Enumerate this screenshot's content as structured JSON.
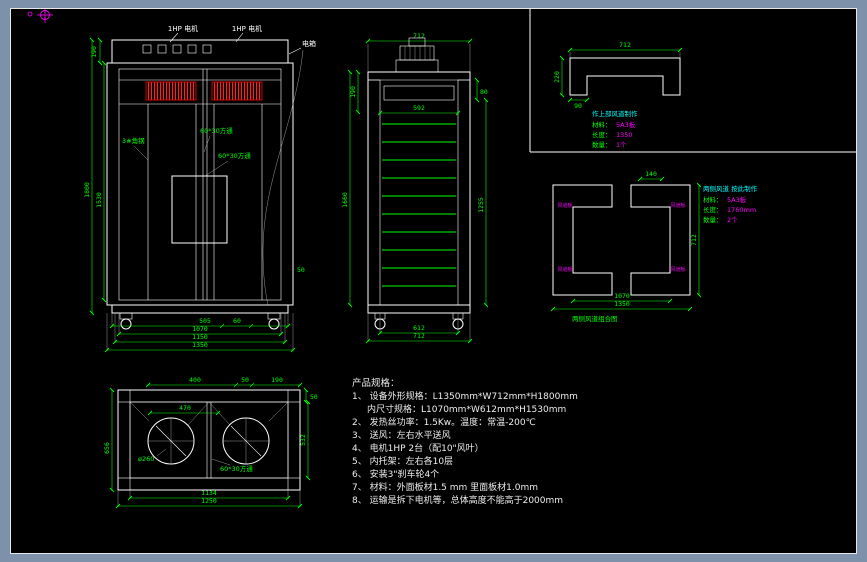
{
  "front_view": {
    "labels": {
      "motor_left": "1HP 电机",
      "motor_right": "1HP 电机",
      "box": "电箱",
      "angle_steel": "3#角钢",
      "tube_a": "60*30方通",
      "tube_b": "60*30方通"
    },
    "dims": {
      "top_height": "190",
      "total_height": "1800",
      "inner_height": "1530",
      "base": "50",
      "seg_505": "505",
      "seg_60": "60",
      "inner_width": "1070",
      "mid_width": "1150",
      "total_width": "1350"
    }
  },
  "side_view": {
    "dims": {
      "top_width": "712",
      "top_seg": "190",
      "shelf_zone": "1660",
      "inner_width": "592",
      "gap": "80",
      "right_height": "1255",
      "inner_width_bottom": "612",
      "total_width_bottom": "712"
    }
  },
  "detail_top": {
    "dims": {
      "width": "712",
      "height": "220",
      "notch": "90"
    },
    "note": {
      "line1": "作上部风道制作",
      "mat_label": "材料：",
      "mat_value": "5A3板",
      "len_label": "长度：",
      "len_value": "1350",
      "qty_label": "数量：",
      "qty_value": "1个"
    }
  },
  "detail_side": {
    "dims": {
      "gap": "140",
      "height": "712",
      "inner_width": "1070",
      "total_width": "1350"
    },
    "part_labels": [
      "风道板",
      "风道板",
      "风道板",
      "风道板"
    ],
    "note": {
      "line1": "两侧风道 按此制作",
      "mat_label": "材料：",
      "mat_value": "5A3板",
      "len_label": "长度：",
      "len_value": "1760mm",
      "qty_label": "数量：",
      "qty_value": "2个"
    },
    "caption": "两侧风道组合图"
  },
  "top_view": {
    "labels": {
      "diameter": "ø260",
      "tube": "60*30方通"
    },
    "dims": {
      "d400": "400",
      "d50_top": "50",
      "d190": "190",
      "d470": "470",
      "d532": "532",
      "d50_right": "50",
      "d656": "656",
      "d1134": "1134",
      "d1250": "1250"
    }
  },
  "specs": {
    "title": "产品规格：",
    "lines": [
      "1、 设备外形规格：L1350mm*W712mm*H1800mm",
      "内尺寸规格：L1070mm*W612mm*H1530mm",
      "2、 发热丝功率：1.5Kw。温度：常温-200℃",
      "3、 送风：左右水平送风",
      "4、 电机1HP 2台（配10\"风叶）",
      "5、 内托架：左右各10层",
      "6、 安装3\"刹车轮4个",
      "7、 材料：外面板材1.5 mm 里面板材1.0mm",
      "8、 运输是拆下电机等，总体高度不能高于2000mm"
    ]
  }
}
